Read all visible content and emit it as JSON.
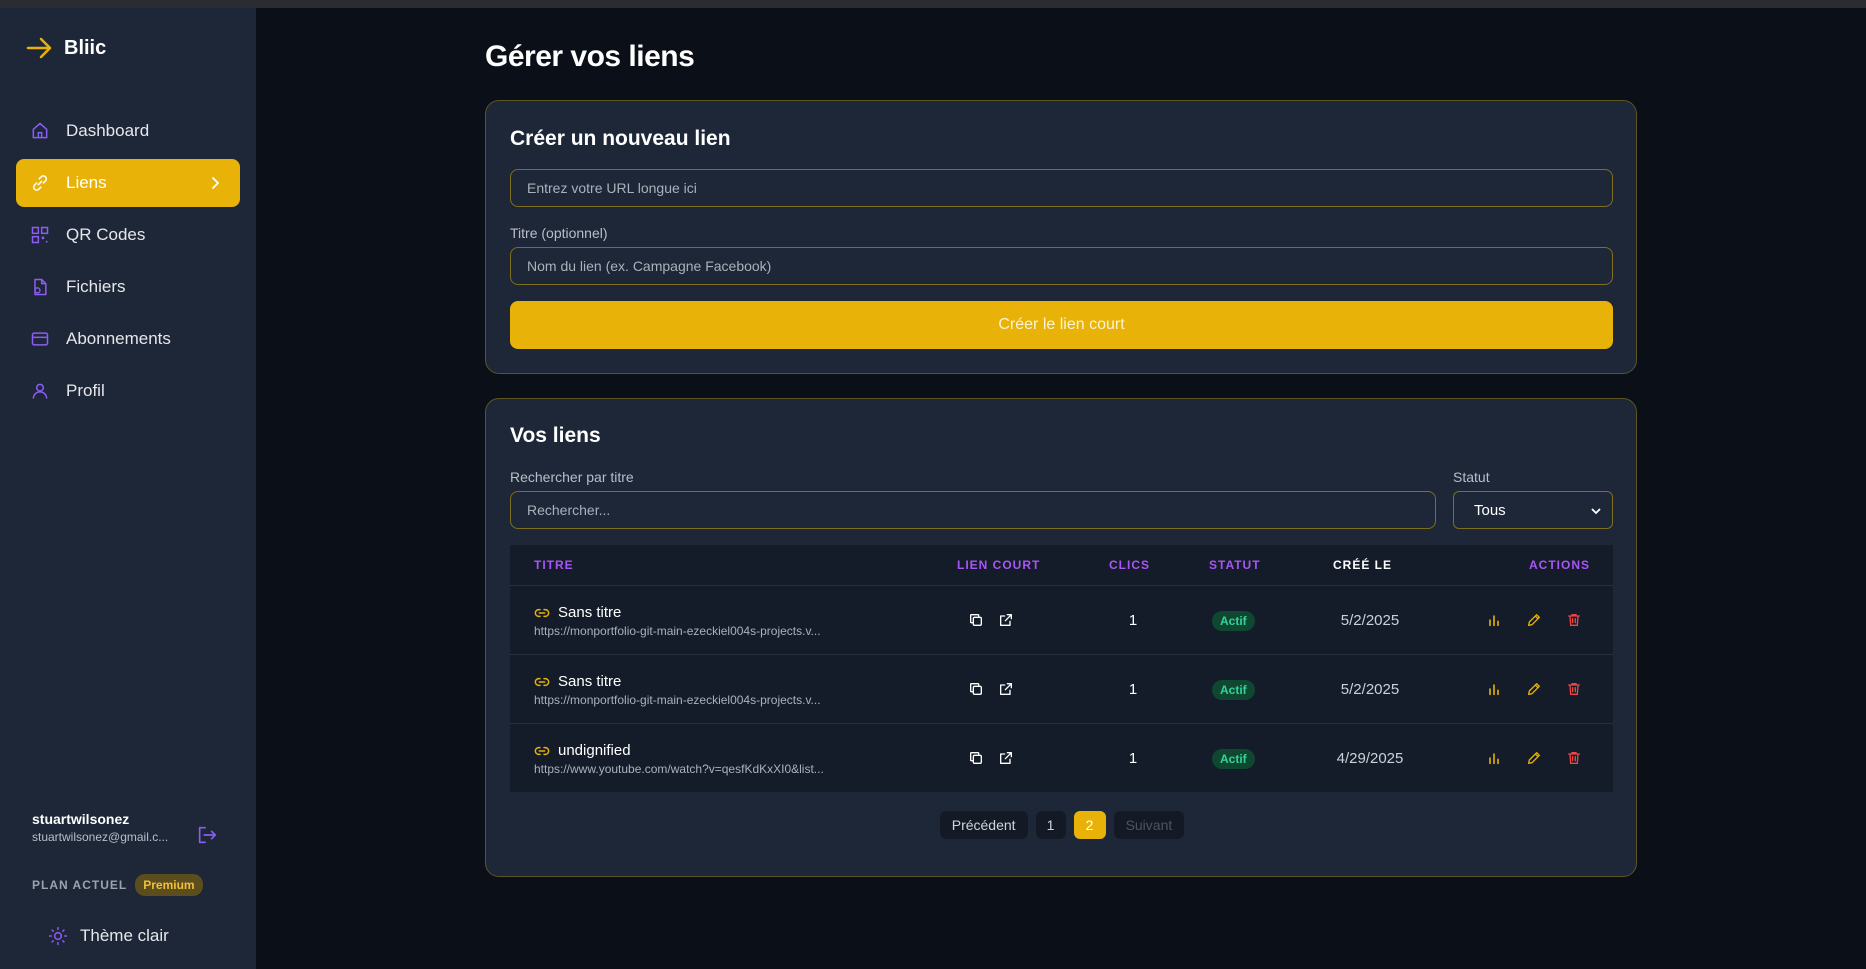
{
  "app": {
    "brand": "Bliic"
  },
  "sidebar": {
    "items": [
      {
        "label": "Dashboard",
        "icon": "home-icon"
      },
      {
        "label": "Liens",
        "icon": "link-icon",
        "active": true
      },
      {
        "label": "QR Codes",
        "icon": "qr-code-icon"
      },
      {
        "label": "Fichiers",
        "icon": "file-icon"
      },
      {
        "label": "Abonnements",
        "icon": "credit-card-icon"
      },
      {
        "label": "Profil",
        "icon": "user-icon"
      }
    ],
    "user": {
      "name": "stuartwilsonez",
      "email": "stuartwilsonez@gmail.c..."
    },
    "plan_label": "PLAN ACTUEL",
    "plan_badge": "Premium",
    "theme_toggle": "Thème clair"
  },
  "main": {
    "title": "Gérer vos liens",
    "create": {
      "heading": "Créer un nouveau lien",
      "url_placeholder": "Entrez votre URL longue ici",
      "title_label": "Titre (optionnel)",
      "title_placeholder": "Nom du lien (ex. Campagne Facebook)",
      "submit": "Créer le lien court"
    },
    "links": {
      "heading": "Vos liens",
      "search_label": "Rechercher par titre",
      "search_placeholder": "Rechercher...",
      "status_label": "Statut",
      "status_selected": "Tous",
      "columns": [
        "TITRE",
        "LIEN COURT",
        "CLICS",
        "STATUT",
        "CRÉÉ LE",
        "ACTIONS"
      ],
      "rows": [
        {
          "title": "Sans titre",
          "url": "https://monportfolio-git-main-ezeckiel004s-projects.v...",
          "clicks": "1",
          "status": "Actif",
          "created": "5/2/2025"
        },
        {
          "title": "Sans titre",
          "url": "https://monportfolio-git-main-ezeckiel004s-projects.v...",
          "clicks": "1",
          "status": "Actif",
          "created": "5/2/2025"
        },
        {
          "title": "undignified",
          "url": "https://www.youtube.com/watch?v=qesfKdKxXI0&list...",
          "clicks": "1",
          "status": "Actif",
          "created": "4/29/2025"
        }
      ],
      "pagination": {
        "prev": "Précédent",
        "pages": [
          "1",
          "2"
        ],
        "current": "2",
        "next": "Suivant"
      }
    }
  },
  "colors": {
    "accent": "#e8b208",
    "purple": "#a855f7",
    "success": "#34d399",
    "danger": "#ef4444"
  }
}
